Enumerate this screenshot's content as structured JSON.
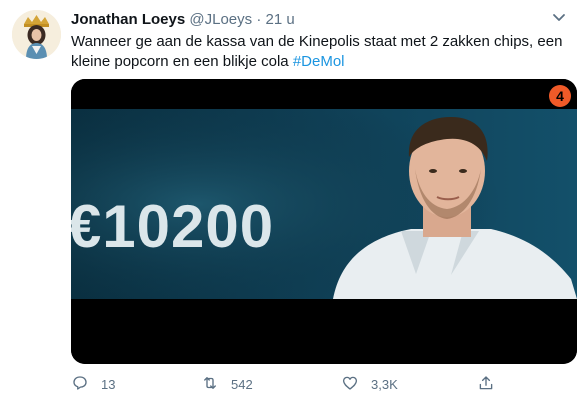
{
  "tweet": {
    "display_name": "Jonathan Loeys",
    "handle": "@JLoeys",
    "separator": "·",
    "time": "21 u",
    "text_part1": "Wanneer ge aan de kassa van de Kinepolis staat met 2 zakken chips, een kleine popcorn en een blikje cola ",
    "hashtag": "#DeMol",
    "media": {
      "amount_text": "€10200",
      "channel_logo_text": "4"
    }
  },
  "actions": {
    "reply_count": "13",
    "retweet_count": "542",
    "like_count": "3,3K"
  },
  "colors": {
    "link": "#1b95e0",
    "muted": "#5b7083",
    "logo": "#f05a28",
    "screen": "#0e3a4e"
  },
  "icons": [
    "more-icon",
    "reply-icon",
    "retweet-icon",
    "like-icon",
    "share-icon"
  ]
}
